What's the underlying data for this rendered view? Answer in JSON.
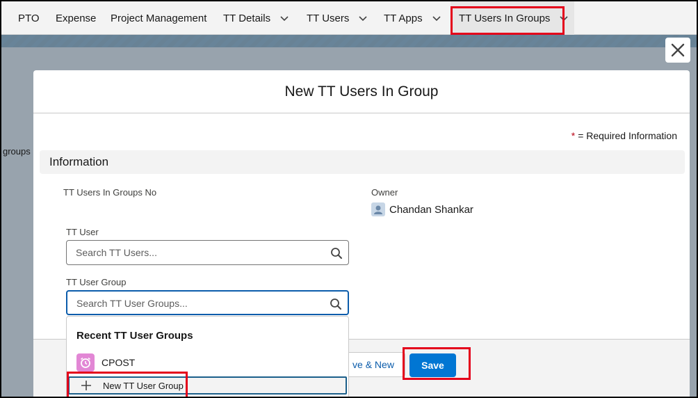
{
  "nav": {
    "items": [
      {
        "label": "PTO",
        "dropdown": false
      },
      {
        "label": "Expense",
        "dropdown": false
      },
      {
        "label": "Project Management",
        "dropdown": false
      },
      {
        "label": "TT Details",
        "dropdown": true
      },
      {
        "label": "TT Users",
        "dropdown": true
      },
      {
        "label": "TT Apps",
        "dropdown": true
      },
      {
        "label": "TT Users In Groups",
        "dropdown": true,
        "active": true
      }
    ]
  },
  "background": {
    "partial_text": "groups"
  },
  "modal": {
    "title": "New TT Users In Group",
    "required_note": "= Required Information",
    "required_marker": "*",
    "section_title": "Information",
    "fields": {
      "record_no_label": "TT Users In Groups No",
      "owner_label": "Owner",
      "owner_value": "Chandan Shankar",
      "tt_user_label": "TT User",
      "tt_user_placeholder": "Search TT Users...",
      "tt_user_group_label": "TT User Group",
      "tt_user_group_placeholder": "Search TT User Groups..."
    },
    "footer": {
      "save_new_label": "ve & New",
      "save_label": "Save"
    }
  },
  "dropdown": {
    "heading": "Recent TT User Groups",
    "recent_items": [
      {
        "label": "CPOST",
        "icon": "alarm-clock-icon"
      }
    ],
    "new_label": "New TT User Group"
  },
  "colors": {
    "brand_blue": "#0176d3",
    "highlight_red": "#e4001b",
    "required_red": "#ba0517"
  }
}
